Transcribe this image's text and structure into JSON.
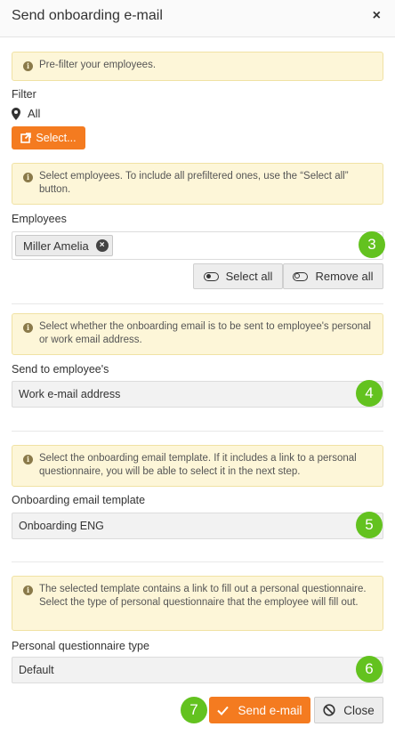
{
  "dialog": {
    "title": "Send onboarding e-mail",
    "close_symbol": "×"
  },
  "prefilter": {
    "notice": "Pre-filter your employees.",
    "filter_label": "Filter",
    "filter_value": "All",
    "select_button": "Select..."
  },
  "employees": {
    "notice": "Select employees. To include all prefiltered ones, use the “Select all” button.",
    "label": "Employees",
    "selected": [
      "Miller Amelia"
    ],
    "select_all": "Select all",
    "remove_all": "Remove all",
    "step": "3"
  },
  "send_to": {
    "notice": "Select whether the onboarding email is to be sent to employee's personal or work email address.",
    "label": "Send to employee's",
    "value": "Work e-mail address",
    "step": "4"
  },
  "template": {
    "notice": "Select the onboarding email template. If it includes a link to a personal questionnaire, you will be able to select it in the next step.",
    "label": "Onboarding email template",
    "value": "Onboarding ENG",
    "step": "5"
  },
  "questionnaire": {
    "notice": "The selected template contains a link to fill out a personal questionnaire. Select the type of personal questionnaire that the employee will fill out.",
    "label": "Personal questionnaire type",
    "value": "Default",
    "step": "6"
  },
  "footer": {
    "send": "Send e-mail",
    "close": "Close",
    "step": "7"
  },
  "colors": {
    "accent": "#f47b20",
    "step_badge": "#63c21f",
    "notice_bg": "#fdf6d8"
  },
  "icons": [
    "info-icon",
    "map-marker-icon",
    "external-link-icon",
    "remove-tag-icon",
    "toggle-on-icon",
    "toggle-off-icon",
    "checkmark-icon",
    "ban-icon",
    "close-icon"
  ]
}
